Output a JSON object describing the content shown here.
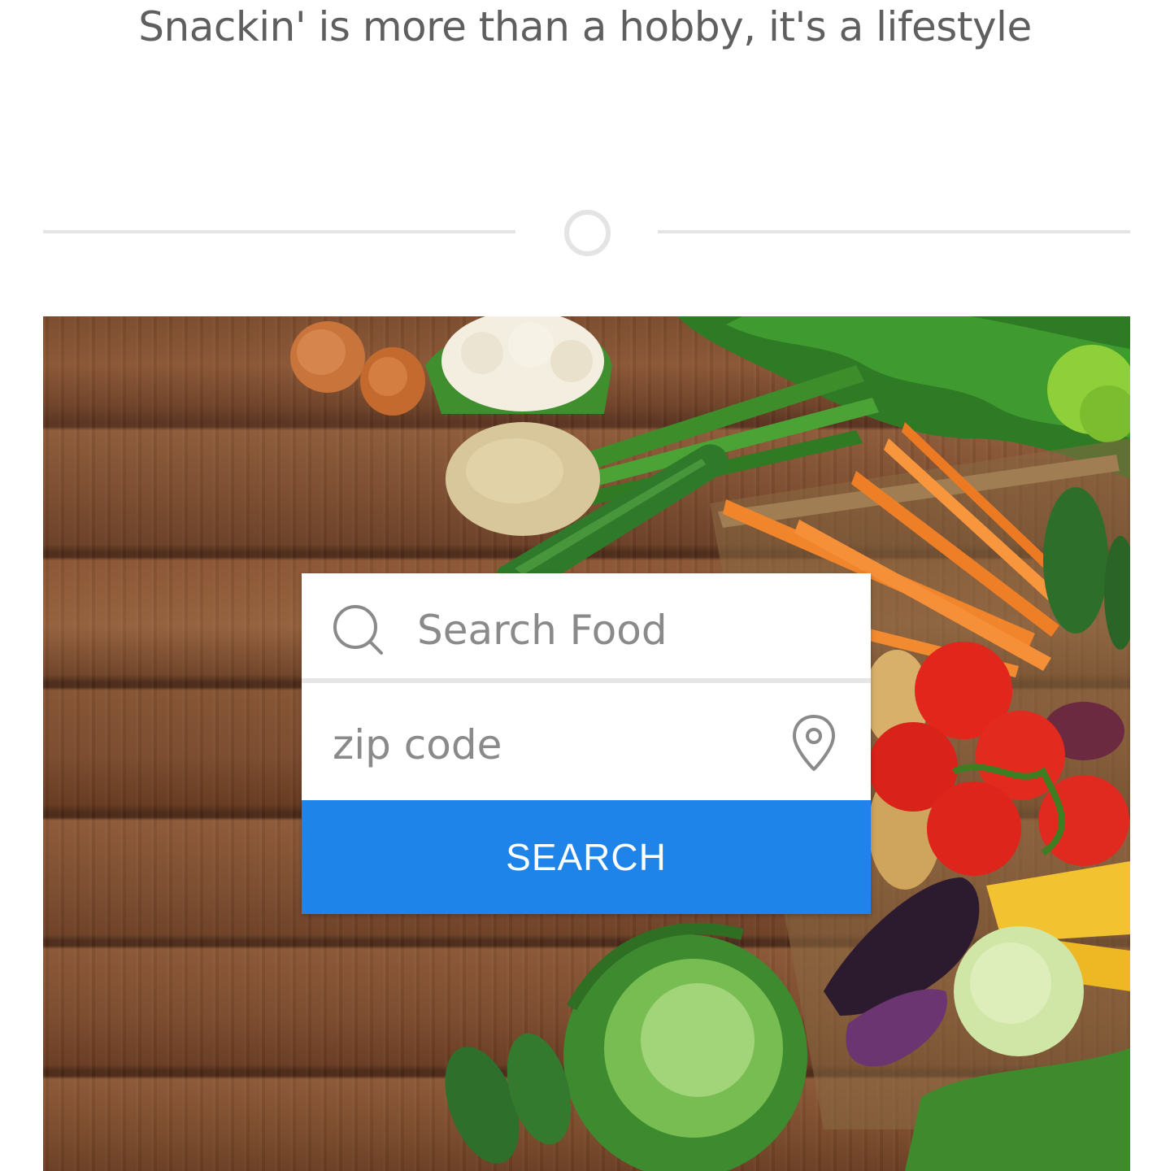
{
  "header": {
    "tagline": "Snackin' is more than a hobby, it's a lifestyle"
  },
  "hero": {
    "background": "vegetables-on-wooden-table-photo"
  },
  "search": {
    "food_placeholder": "Search Food",
    "food_icon": "search-icon",
    "zip_placeholder": "zip code",
    "zip_icon": "location-pin-icon",
    "button_label": "SEARCH",
    "button_color": "#1f84ea"
  }
}
